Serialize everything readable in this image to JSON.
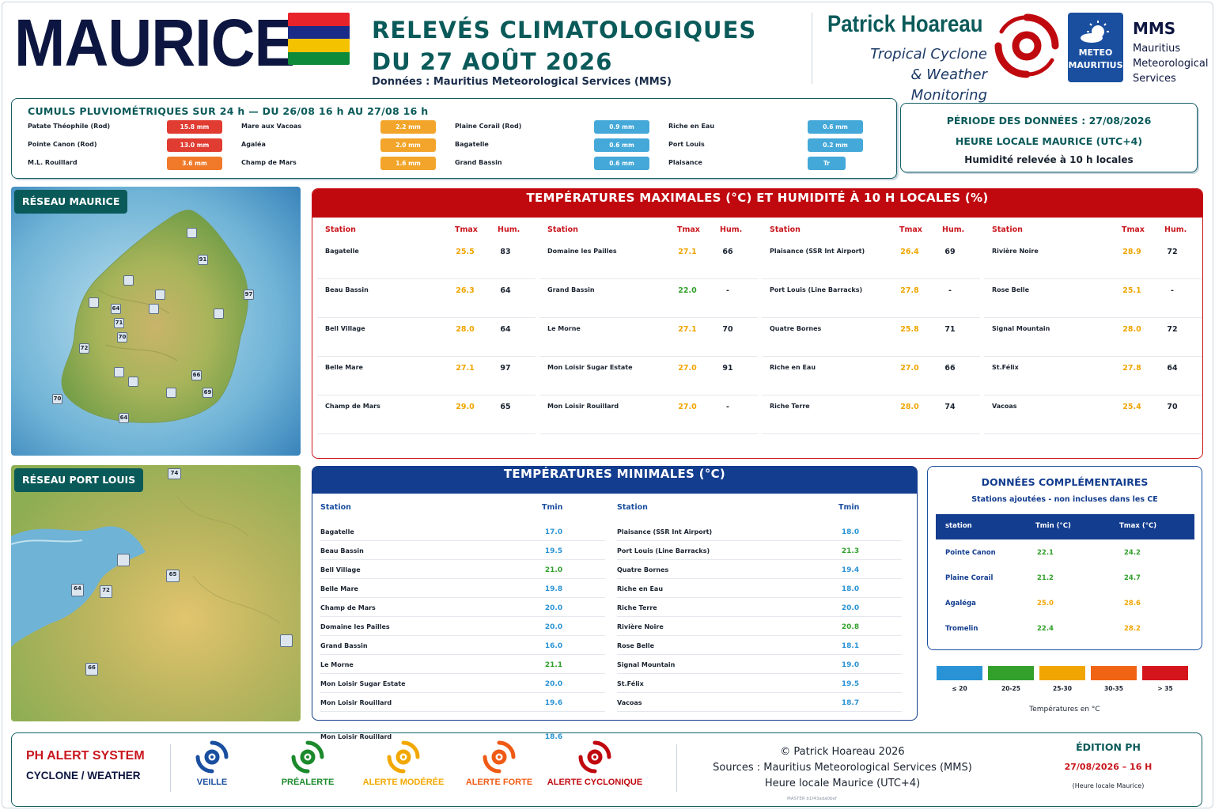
{
  "colors": {
    "teal": "#0b5a5a",
    "navy": "#0d1640",
    "red": "#c0080f",
    "blue": "#133d8f",
    "t_le20": "#2a93d5",
    "t_20_25": "#33a02c",
    "t_25_30": "#f0a500",
    "t_30_35": "#f06414",
    "t_gt35": "#d4161c",
    "rain_high": "#e03c31",
    "rain_mid_high": "#f07a2a",
    "rain_mid": "#f2a52a",
    "rain_low": "#44a8d8"
  },
  "header": {
    "title": "MAURICE",
    "flag_colors": [
      "#e8232a",
      "#1a2b88",
      "#f5c200",
      "#0d8a3a"
    ],
    "release_line1": "RELEVÉS CLIMATOLOGIQUES",
    "release_line2": "DU 27 AOÛT 2026",
    "source": "Données : Mauritius Meteorological Services (MMS)",
    "brand_name": "Patrick Hoareau",
    "brand_sub1": "Tropical Cyclone",
    "brand_sub2": "& Weather Monitoring",
    "mms_logo_line1": "METEO",
    "mms_logo_line2": "MAURITIUS",
    "mms_title": "MMS",
    "mms_sub1": "Mauritius",
    "mms_sub2": "Meteorological",
    "mms_sub3": "Services"
  },
  "rainfall": {
    "title": "CUMULS PLUVIOMÉTRIQUES SUR 24 h — DU 26/08 16 h AU 27/08 16 h",
    "columns": [
      [
        {
          "station": "Patate Théophile (Rod)",
          "value": "15.8 mm",
          "level": "high"
        },
        {
          "station": "Pointe Canon (Rod)",
          "value": "13.0 mm",
          "level": "high"
        },
        {
          "station": "M.L. Rouillard",
          "value": "3.6 mm",
          "level": "mid_high"
        }
      ],
      [
        {
          "station": "Mare aux Vacoas",
          "value": "2.2 mm",
          "level": "mid"
        },
        {
          "station": "Agaléa",
          "value": "2.0 mm",
          "level": "mid"
        },
        {
          "station": "Champ de Mars",
          "value": "1.6 mm",
          "level": "mid"
        }
      ],
      [
        {
          "station": "Plaine Corail (Rod)",
          "value": "0.9 mm",
          "level": "low"
        },
        {
          "station": "Bagatelle",
          "value": "0.6 mm",
          "level": "low"
        },
        {
          "station": "Grand Bassin",
          "value": "0.6 mm",
          "level": "low"
        }
      ],
      [
        {
          "station": "Riche en Eau",
          "value": "0.6 mm",
          "level": "low"
        },
        {
          "station": "Port Louis",
          "value": "0.2 mm",
          "level": "low"
        },
        {
          "station": "Plaisance",
          "value": "Tr",
          "level": "low"
        }
      ]
    ]
  },
  "period": {
    "line1": "PÉRIODE DES DONNÉES : 27/08/2026",
    "line2": "HEURE LOCALE MAURICE (UTC+4)",
    "line3": "Humidité relevée à 10 h locales"
  },
  "map_mauritius": {
    "label": "RÉSEAU MAURICE",
    "markers": [
      "91",
      "97",
      "64",
      "71",
      "70",
      "72",
      "66",
      "69",
      "70",
      "64"
    ]
  },
  "map_portlouis": {
    "label": "RÉSEAU PORT LOUIS",
    "markers": [
      "74",
      "65",
      "64",
      "72",
      "66"
    ]
  },
  "tmax": {
    "title": "TEMPÉRATURES MAXIMALES (°C) ET HUMIDITÉ À 10 H LOCALES (%)",
    "col_station": "Station",
    "col_tmax": "Tmax",
    "col_hum": "Hum.",
    "columns": [
      [
        {
          "station": "Bagatelle",
          "tmax": "25.5",
          "hum": "83",
          "band": "t_25_30"
        },
        {
          "station": "Beau Bassin",
          "tmax": "26.3",
          "hum": "64",
          "band": "t_25_30"
        },
        {
          "station": "Bell Village",
          "tmax": "28.0",
          "hum": "64",
          "band": "t_25_30"
        },
        {
          "station": "Belle Mare",
          "tmax": "27.1",
          "hum": "97",
          "band": "t_25_30"
        },
        {
          "station": "Champ de Mars",
          "tmax": "29.0",
          "hum": "65",
          "band": "t_25_30"
        }
      ],
      [
        {
          "station": "Domaine les Pailles",
          "tmax": "27.1",
          "hum": "66",
          "band": "t_25_30"
        },
        {
          "station": "Grand Bassin",
          "tmax": "22.0",
          "hum": "-",
          "band": "t_20_25"
        },
        {
          "station": "Le Morne",
          "tmax": "27.1",
          "hum": "70",
          "band": "t_25_30"
        },
        {
          "station": "Mon Loisir Sugar Estate",
          "tmax": "27.0",
          "hum": "91",
          "band": "t_25_30"
        },
        {
          "station": "Mon Loisir Rouillard",
          "tmax": "27.0",
          "hum": "-",
          "band": "t_25_30"
        }
      ],
      [
        {
          "station": "Plaisance (SSR Int Airport)",
          "tmax": "26.4",
          "hum": "69",
          "band": "t_25_30"
        },
        {
          "station": "Port Louis (Line Barracks)",
          "tmax": "27.8",
          "hum": "-",
          "band": "t_25_30"
        },
        {
          "station": "Quatre Bornes",
          "tmax": "25.8",
          "hum": "71",
          "band": "t_25_30"
        },
        {
          "station": "Riche en Eau",
          "tmax": "27.0",
          "hum": "66",
          "band": "t_25_30"
        },
        {
          "station": "Riche Terre",
          "tmax": "28.0",
          "hum": "74",
          "band": "t_25_30"
        }
      ],
      [
        {
          "station": "Rivière Noire",
          "tmax": "28.9",
          "hum": "72",
          "band": "t_25_30"
        },
        {
          "station": "Rose Belle",
          "tmax": "25.1",
          "hum": "-",
          "band": "t_25_30"
        },
        {
          "station": "Signal Mountain",
          "tmax": "28.0",
          "hum": "72",
          "band": "t_25_30"
        },
        {
          "station": "St.Félix",
          "tmax": "27.8",
          "hum": "64",
          "band": "t_25_30"
        },
        {
          "station": "Vacoas",
          "tmax": "25.4",
          "hum": "70",
          "band": "t_25_30"
        }
      ]
    ]
  },
  "tmin": {
    "title": "TEMPÉRATURES MINIMALES (°C)",
    "col_station": "Station",
    "col_tmin": "Tmin",
    "columns": [
      [
        {
          "station": "Bagatelle",
          "tmin": "17.0",
          "band": "t_le20"
        },
        {
          "station": "Beau Bassin",
          "tmin": "19.5",
          "band": "t_le20"
        },
        {
          "station": "Bell Village",
          "tmin": "21.0",
          "band": "t_20_25"
        },
        {
          "station": "Belle Mare",
          "tmin": "19.8",
          "band": "t_le20"
        },
        {
          "station": "Champ de Mars",
          "tmin": "20.0",
          "band": "t_le20"
        },
        {
          "station": "Domaine les Pailles",
          "tmin": "20.0",
          "band": "t_le20"
        },
        {
          "station": "Grand Bassin",
          "tmin": "16.0",
          "band": "t_le20"
        },
        {
          "station": "Le Morne",
          "tmin": "21.1",
          "band": "t_20_25"
        },
        {
          "station": "Mon Loisir Sugar Estate",
          "tmin": "20.0",
          "band": "t_le20"
        },
        {
          "station": "Mon Loisir Rouillard",
          "tmin": "19.6",
          "band": "t_le20"
        }
      ],
      [
        {
          "station": "Plaisance (SSR Int Airport)",
          "tmin": "18.0",
          "band": "t_le20"
        },
        {
          "station": "Port Louis (Line Barracks)",
          "tmin": "21.3",
          "band": "t_20_25"
        },
        {
          "station": "Quatre Bornes",
          "tmin": "19.4",
          "band": "t_le20"
        },
        {
          "station": "Riche en Eau",
          "tmin": "18.0",
          "band": "t_le20"
        },
        {
          "station": "Riche Terre",
          "tmin": "20.0",
          "band": "t_le20"
        },
        {
          "station": "Rivière Noire",
          "tmin": "20.8",
          "band": "t_20_25"
        },
        {
          "station": "Rose Belle",
          "tmin": "18.1",
          "band": "t_le20"
        },
        {
          "station": "Signal Mountain",
          "tmin": "19.0",
          "band": "t_le20"
        },
        {
          "station": "St.Félix",
          "tmin": "19.5",
          "band": "t_le20"
        },
        {
          "station": "Vacoas",
          "tmin": "18.7",
          "band": "t_le20"
        }
      ]
    ],
    "overflow_row": {
      "station": "Mon Loisir Rouillard",
      "tmin": "18.6",
      "band": "t_le20"
    }
  },
  "complement": {
    "title": "DONNÉES COMPLÉMENTAIRES",
    "subtitle": "Stations ajoutées - non incluses dans les CE",
    "col_station": "station",
    "col_tmin": "Tmin (°C)",
    "col_tmax": "Tmax (°C)",
    "rows": [
      {
        "station": "Pointe Canon",
        "tmin": "22.1",
        "tmax": "24.2",
        "tmin_band": "t_20_25",
        "tmax_band": "t_20_25"
      },
      {
        "station": "Plaine Corail",
        "tmin": "21.2",
        "tmax": "24.7",
        "tmin_band": "t_20_25",
        "tmax_band": "t_20_25"
      },
      {
        "station": "Agaléga",
        "tmin": "25.0",
        "tmax": "28.6",
        "tmin_band": "t_25_30",
        "tmax_band": "t_25_30"
      },
      {
        "station": "Tromelin",
        "tmin": "22.4",
        "tmax": "28.2",
        "tmin_band": "t_20_25",
        "tmax_band": "t_25_30"
      }
    ]
  },
  "legend": {
    "items": [
      {
        "label": "≤ 20",
        "band": "t_le20"
      },
      {
        "label": "20-25",
        "band": "t_20_25"
      },
      {
        "label": "25-30",
        "band": "t_25_30"
      },
      {
        "label": "30-35",
        "band": "t_30_35"
      },
      {
        "label": "> 35",
        "band": "t_gt35"
      }
    ],
    "caption": "Températures en °C"
  },
  "footer": {
    "system_line1": "PH ALERT SYSTEM",
    "system_line2": "CYCLONE / WEATHER",
    "alerts": [
      {
        "label": "VEILLE",
        "color": "#1a4fa0"
      },
      {
        "label": "PRÉALERTE",
        "color": "#1c8a2c"
      },
      {
        "label": "ALERTE MODÉRÉE",
        "color": "#f2a800"
      },
      {
        "label": "ALERTE FORTE",
        "color": "#ef5a14"
      },
      {
        "label": "ALERTE CYCLONIQUE",
        "color": "#c0080f"
      }
    ],
    "copyright": "© Patrick Hoareau 2026",
    "sources": "Sources : Mauritius Meteorological Services (MMS)",
    "local_time": "Heure locale Maurice (UTC+4)",
    "master": "MASTER b1f43ada0bef",
    "edition_title": "ÉDITION PH",
    "edition_date": "27/08/2026 – 16 H",
    "edition_note": "(Heure locale Maurice)"
  }
}
